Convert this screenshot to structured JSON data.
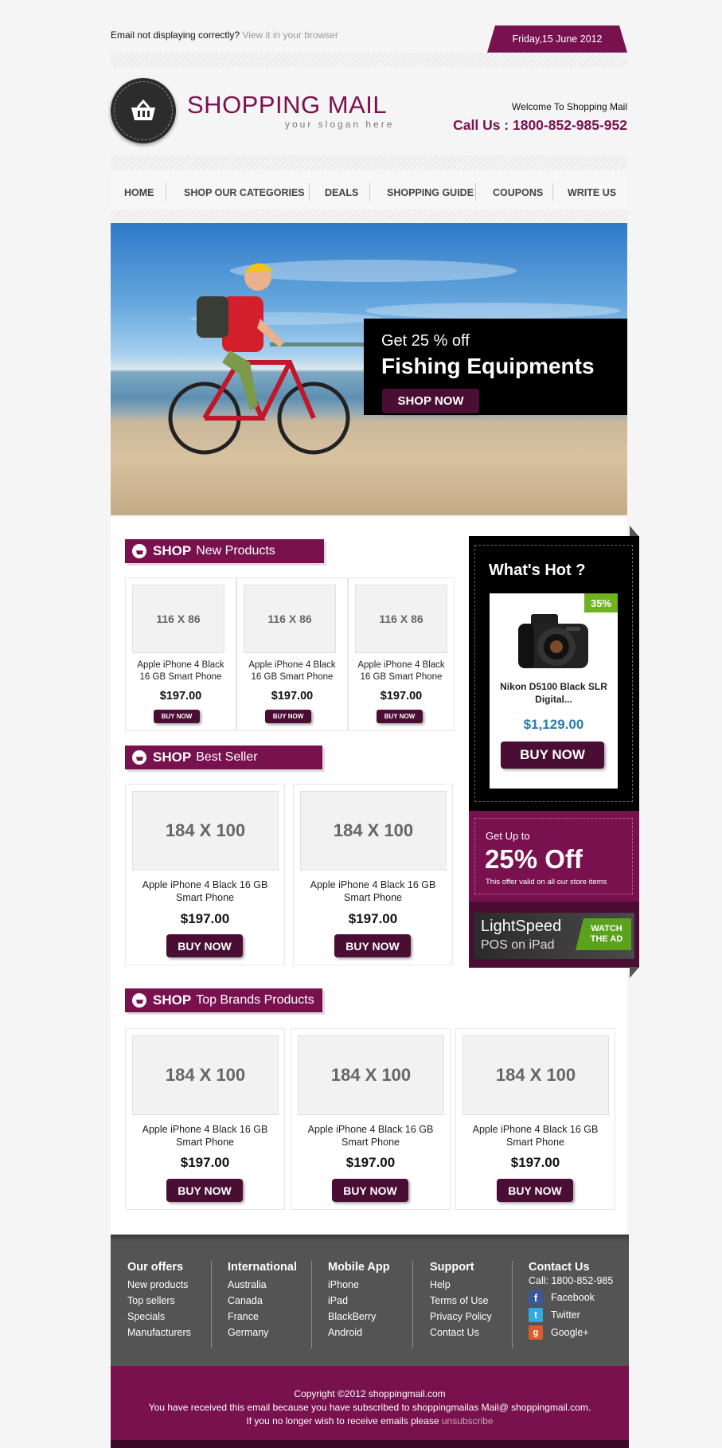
{
  "topbar": {
    "notice": "Email not displaying correctly?",
    "view_link": "View it in your browser",
    "date": "Friday,15 June 2012"
  },
  "header": {
    "brand": "SHOPPING MAIL",
    "slogan": "your slogan here",
    "welcome": "Welcome To Shopping Mail",
    "call": "Call Us : 1800-852-985-952"
  },
  "nav": [
    "HOME",
    "SHOP OUR CATEGORIES",
    "DEALS",
    "SHOPPING GUIDE",
    "COUPONS",
    "WRITE US"
  ],
  "hero": {
    "line1": "Get 25 % off",
    "line2": "Fishing Equipments",
    "button": "SHOP NOW"
  },
  "sections": {
    "new_products": {
      "shop": "SHOP",
      "title": "New Products",
      "placeholder": "116 X 86",
      "name_line1": "Apple iPhone 4 Black",
      "name_line2": "16 GB Smart Phone",
      "price": "$197.00",
      "button": "BUY NOW"
    },
    "best_seller": {
      "shop": "SHOP",
      "title": "Best Seller",
      "placeholder": "184 X 100",
      "name_line1": "Apple iPhone 4 Black 16 GB",
      "name_line2": "Smart Phone",
      "price": "$197.00",
      "button": "BUY NOW"
    },
    "top_brands": {
      "shop": "SHOP",
      "title": "Top Brands Products",
      "placeholder": "184 X 100",
      "name_line1": "Apple iPhone 4 Black 16 GB",
      "name_line2": "Smart Phone",
      "price": "$197.00",
      "button": "BUY NOW"
    }
  },
  "hot": {
    "title": "What's Hot ?",
    "badge": "35%",
    "name_line1": "Nikon D5100 Black SLR",
    "name_line2": "Digital...",
    "price": "$1,129.00",
    "button": "BUY NOW"
  },
  "promo": {
    "small": "Get Up to",
    "big": "25% Off",
    "note": "This offer valid on all our store items"
  },
  "ad": {
    "brand": "LightSpeed",
    "sub": "POS on iPad",
    "watch1": "WATCH",
    "watch2": "THE AD"
  },
  "footer": {
    "offers": {
      "title": "Our offers",
      "items": [
        "New products",
        "Top sellers",
        "Specials",
        "Manufacturers"
      ]
    },
    "international": {
      "title": "International",
      "items": [
        "Australia",
        "Canada",
        "France",
        "Germany"
      ]
    },
    "mobile": {
      "title": "Mobile App",
      "items": [
        "iPhone",
        "iPad",
        "BlackBerry",
        "Android"
      ]
    },
    "support": {
      "title": "Support",
      "items": [
        "Help",
        "Terms of Use",
        "Privacy Policy",
        "Contact Us"
      ]
    },
    "contact": {
      "title": "Contact Us",
      "call": "Call: 1800-852-985",
      "social": [
        "Facebook",
        "Twitter",
        "Google+"
      ]
    },
    "copyright": "Copyright ©2012 shoppingmail.com",
    "received": "You have received this email because you have subscribed to shoppingmailas Mail@ shoppingmail.com.",
    "unsub_text": "If you no longer wish to receive emails please",
    "unsub_link": "unsubscribe"
  },
  "colors": {
    "primary": "#79114f",
    "button": "#4a0d33",
    "price_blue": "#2a7ab0",
    "badge_green": "#6fb31f"
  }
}
